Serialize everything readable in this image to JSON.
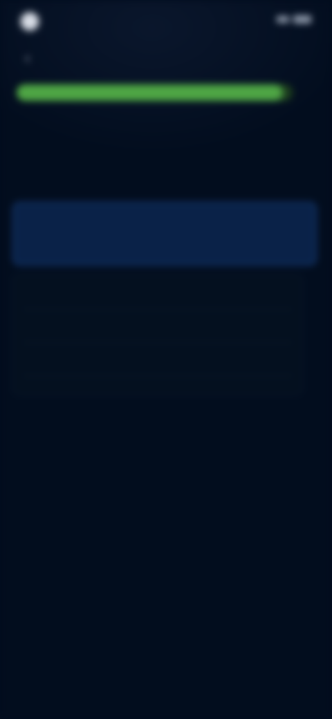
{
  "status_bar": {
    "app_name": "",
    "time_text": "",
    "logo_icon": "app-logo-icon",
    "signal_icon": "signal-icon",
    "battery_icon": "battery-icon"
  },
  "navigation": {
    "back_icon": "chevron-left-icon"
  },
  "progress": {
    "value": 0.96,
    "fill_color": "#4ea544",
    "track_color": "#18331c"
  },
  "question": {
    "title": ""
  },
  "answers": {
    "selected": {
      "label": ""
    },
    "options": [
      {
        "label": ""
      },
      {
        "label": ""
      },
      {
        "label": ""
      }
    ]
  },
  "colors": {
    "background": "#020d1e",
    "selected_border": "#173d78",
    "selected_fill": "#0a2248"
  }
}
